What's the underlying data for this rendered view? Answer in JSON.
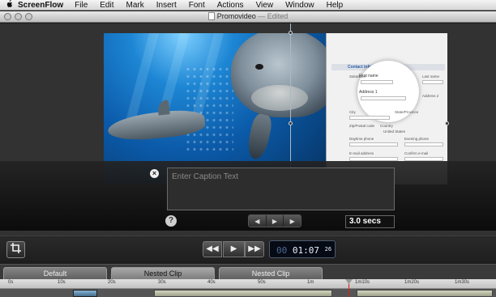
{
  "menubar": {
    "app_name": "ScreenFlow",
    "items": [
      "File",
      "Edit",
      "Mark",
      "Insert",
      "Font",
      "Actions",
      "View",
      "Window",
      "Help"
    ]
  },
  "window": {
    "document_name": "Promovideo",
    "status": "— Edited"
  },
  "preview_form": {
    "section_title": "Contact information",
    "labels": [
      "Salutation",
      "First name",
      "Last name",
      "Address 1",
      "Address 2",
      "City",
      "State/Province",
      "Zip/Postal code",
      "Country",
      "Daytime phone",
      "Evening phone",
      "E-mail address",
      "Confirm e-mail"
    ],
    "country_value": "United States"
  },
  "caption": {
    "placeholder": "Enter Caption Text",
    "close_icon": "close-icon",
    "help_label": "?",
    "duration": "3.0 secs"
  },
  "mini_transport": {
    "prev_icon": "◀",
    "play_icon": "▶",
    "next_icon": "▶"
  },
  "transport": {
    "crop_icon": "crop-icon",
    "rewind_label": "◀◀",
    "play_label": "▶",
    "forward_label": "▶▶",
    "timecode_dim": "00",
    "timecode_main": "01:07",
    "timecode_frames": "26"
  },
  "tracks": [
    "Default",
    "Nested Clip",
    "Nested Clip"
  ],
  "ruler_ticks": [
    "0s",
    "10s",
    "20s",
    "30s",
    "40s",
    "50s",
    "1m",
    "1m10s",
    "1m20s",
    "1m30s"
  ],
  "colors": {
    "timecode_bg": "#050a14",
    "playhead": "#d21"
  }
}
